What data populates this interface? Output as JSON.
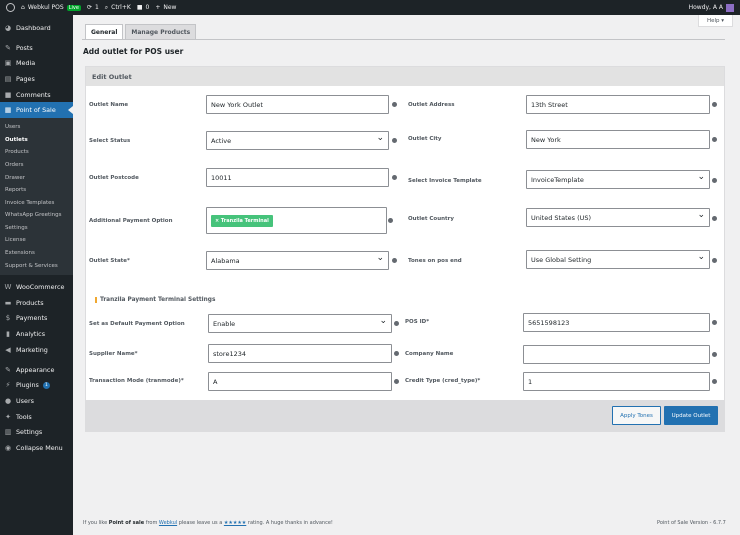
{
  "adminbar": {
    "site_name": "Webkul POS",
    "live_badge": "Live",
    "updates_count": "1",
    "shortcut": "Ctrl+K",
    "comments_count": "0",
    "new_label": "New",
    "howdy": "Howdy, A A"
  },
  "sidebar": {
    "dashboard": "Dashboard",
    "posts": "Posts",
    "media": "Media",
    "pages": "Pages",
    "comments": "Comments",
    "pos": "Point of Sale",
    "sub": [
      "Users",
      "Outlets",
      "Products",
      "Orders",
      "Drawer",
      "Reports",
      "Invoice Templates",
      "WhatsApp Greetings",
      "Settings",
      "License",
      "Extensions",
      "Support & Services"
    ],
    "woocommerce": "WooCommerce",
    "products": "Products",
    "payments": "Payments",
    "analytics": "Analytics",
    "marketing": "Marketing",
    "appearance": "Appearance",
    "plugins": "Plugins",
    "plugins_badge": "1",
    "users": "Users",
    "tools": "Tools",
    "settings": "Settings",
    "collapse": "Collapse Menu"
  },
  "help": "Help ▾",
  "tabs": {
    "general": "General",
    "manage": "Manage Products"
  },
  "page_title": "Add outlet for POS user",
  "panel_title": "Edit Outlet",
  "form": {
    "outlet_name_label": "Outlet Name",
    "outlet_name": "New York Outlet",
    "outlet_address_label": "Outlet Address",
    "outlet_address": "13th Street",
    "status_label": "Select Status",
    "status": "Active",
    "city_label": "Outlet City",
    "city": "New York",
    "postcode_label": "Outlet Postcode",
    "postcode": "10011",
    "invoice_label": "Select Invoice Template",
    "invoice": "InvoiceTemplate",
    "payment_label": "Additional Payment Option",
    "payment_tag": "× Tranzila Terminal",
    "country_label": "Outlet Country",
    "country": "United States (US)",
    "state_label": "Outlet State*",
    "state": "Alabama",
    "tones_label": "Tones on pos end",
    "tones": "Use Global Setting"
  },
  "tranzila": {
    "section_title": "Tranzila Payment Terminal Settings",
    "default_label": "Set as Default Payment Option",
    "default": "Enable",
    "posid_label": "POS ID*",
    "posid": "5651598123",
    "supplier_label": "Supplier Name*",
    "supplier": "store1234",
    "company_label": "Company Name",
    "company": "",
    "tranmode_label": "Transaction Mode (tranmode)*",
    "tranmode": "A",
    "credtype_label": "Credit Type (cred_type)*",
    "credtype": "1"
  },
  "buttons": {
    "apply_tones": "Apply Tones",
    "update_outlet": "Update Outlet"
  },
  "footer": {
    "prefix": "If you like",
    "product": "Point of sale",
    "from": "from",
    "vendor": "Webkul",
    "middle": "please leave us a",
    "stars": "★★★★★",
    "suffix": "rating. A huge thanks in advance!",
    "version": "Point of Sale Version - 6.7.7"
  },
  "colors": {
    "accent": "#2271b1",
    "sidebar": "#1d2327",
    "tag": "#46c37b"
  }
}
